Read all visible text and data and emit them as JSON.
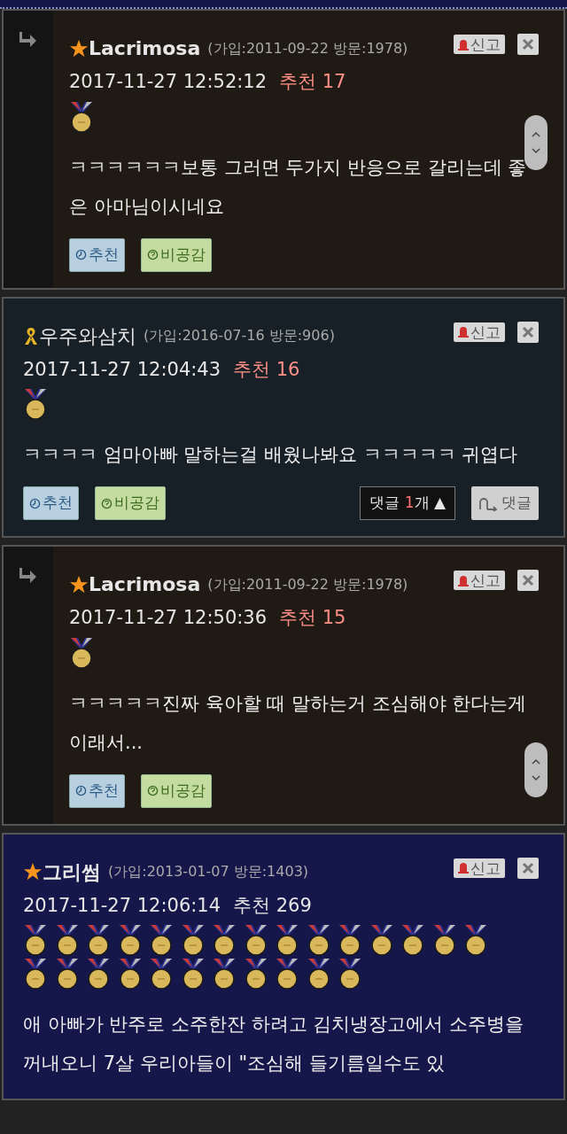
{
  "comments": [
    {
      "kind": "reply",
      "author": {
        "kind": "star",
        "name": "Lacrimosa"
      },
      "meta": "(가입:2011-09-22 방문:1978)",
      "report": "신고",
      "date": "2017-11-27 12:52:12",
      "votes": {
        "text": "추천 17",
        "color": "#ff8f86"
      },
      "medals": [
        {
          "kind": "medal"
        }
      ],
      "body": "ㅋㅋㅋㅋㅋㅋ보통 그러면 두가지 반응으로 갈리는데 좋은 아마님이시네요",
      "like": "추천",
      "dislike": "비공감",
      "scroll_handle": true
    },
    {
      "kind": "normal",
      "author": {
        "kind": "ribbon",
        "name": "우주와삼치"
      },
      "meta": "(가입:2016-07-16 방문:906)",
      "report": "신고",
      "date": "2017-11-27 12:04:43",
      "votes": {
        "text": "추천 16",
        "color": "#ff8f86"
      },
      "medals": [
        {
          "kind": "medal"
        }
      ],
      "body": "ㅋㅋㅋㅋ 엄마아빠 말하는걸 배웠나봐요 ㅋㅋㅋㅋㅋ 귀엽다",
      "like": "추천",
      "dislike": "비공감",
      "scroll_handle": false,
      "reply_count": {
        "label": "댓글 ",
        "count": "1",
        "unit": "개",
        "arrow": "▲"
      },
      "reply_button": "댓글"
    },
    {
      "kind": "reply",
      "author": {
        "kind": "star",
        "name": "Lacrimosa"
      },
      "meta": "(가입:2011-09-22 방문:1978)",
      "report": "신고",
      "date": "2017-11-27 12:50:36",
      "votes": {
        "text": "추천 15",
        "color": "#ff8f86"
      },
      "medals": [
        {
          "kind": "medal"
        }
      ],
      "body": "ㅋㅋㅋㅋㅋ진짜 육아할 때 말하는거 조심해야 한다는게 이래서...",
      "like": "추천",
      "dislike": "비공감",
      "scroll_handle": true
    },
    {
      "kind": "best",
      "author": {
        "kind": "star",
        "name": "그리썸"
      },
      "meta": "(가입:2013-01-07 방문:1403)",
      "report": "신고",
      "date": "2017-11-27 12:06:14",
      "votes": {
        "text": "추천 269",
        "color": "#e6e6e6"
      },
      "medals": [
        {
          "kind": "medal"
        },
        {
          "kind": "medal"
        },
        {
          "kind": "medal"
        },
        {
          "kind": "medal"
        },
        {
          "kind": "medal"
        },
        {
          "kind": "medal"
        },
        {
          "kind": "medal"
        },
        {
          "kind": "medal"
        },
        {
          "kind": "medal"
        },
        {
          "kind": "medal"
        },
        {
          "kind": "medal"
        },
        {
          "kind": "medal"
        },
        {
          "kind": "medal"
        },
        {
          "kind": "medal"
        },
        {
          "kind": "medal"
        },
        {
          "kind": "medal"
        },
        {
          "kind": "medal"
        },
        {
          "kind": "medal"
        },
        {
          "kind": "medal"
        },
        {
          "kind": "medal"
        },
        {
          "kind": "medal"
        },
        {
          "kind": "medal"
        },
        {
          "kind": "medal"
        },
        {
          "kind": "medal"
        },
        {
          "kind": "medal"
        },
        {
          "kind": "medal"
        }
      ],
      "body": "애 아빠가 반주로 소주한잔 하려고 김치냉장고에서 소주병을 꺼내오니 7살 우리아들이 \"조심해 들기름일수도 있",
      "scroll_handle": false
    }
  ]
}
